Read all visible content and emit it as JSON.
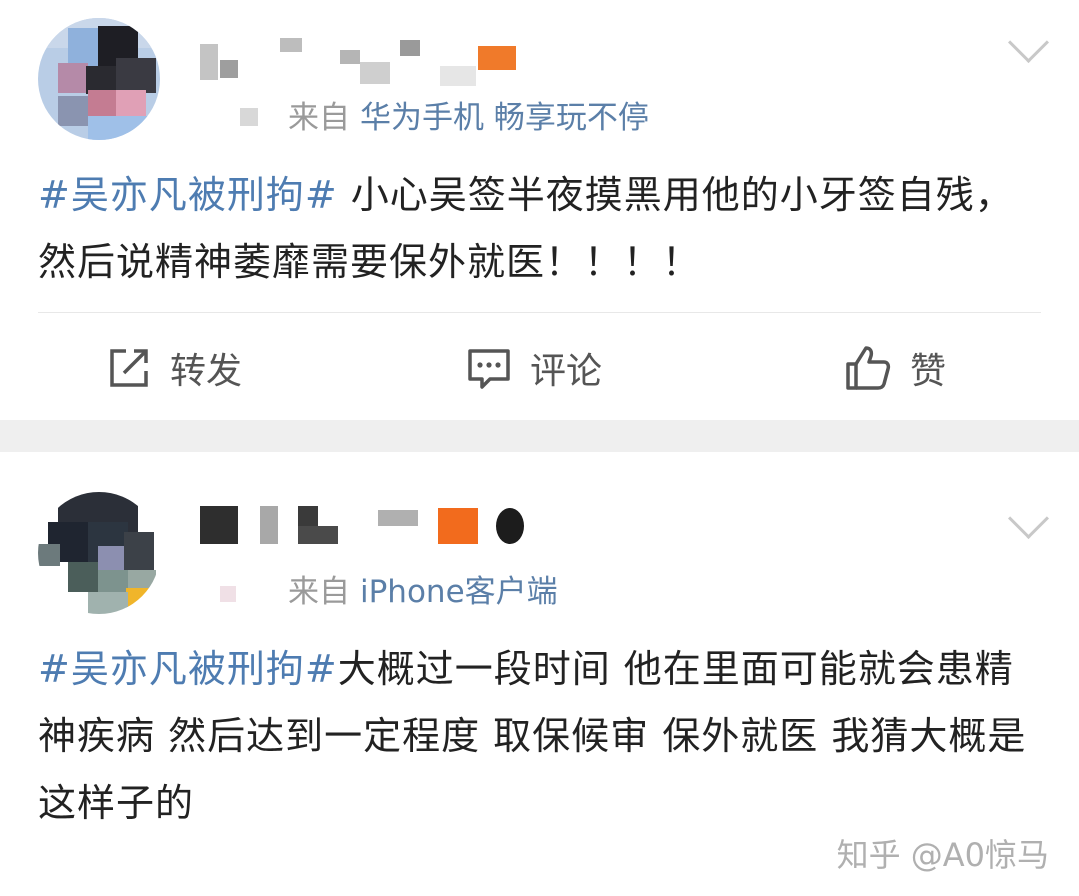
{
  "posts": [
    {
      "source_prefix": "来自",
      "source_client": "华为手机 畅享玩不停",
      "hashtag": "#吴亦凡被刑拘#",
      "text": " 小心吴签半夜摸黑用他的小牙签自残，然后说精神萎靡需要保外就医！！！！",
      "actions": {
        "repost": "转发",
        "comment": "评论",
        "like": "赞"
      }
    },
    {
      "source_prefix": "来自",
      "source_client": "iPhone客户端",
      "hashtag": "#吴亦凡被刑拘#",
      "text": "大概过一段时间 他在里面可能就会患精神疾病 然后达到一定程度 取保候审 保外就医 我猜大概是这样子的"
    }
  ],
  "watermark": "知乎 @A0惊马",
  "colors": {
    "link": "#4e7cb1",
    "source_client": "#5b7fa8",
    "gap": "#efefef"
  },
  "icons": [
    "repost-icon",
    "comment-icon",
    "like-icon",
    "chevron-down-icon"
  ]
}
